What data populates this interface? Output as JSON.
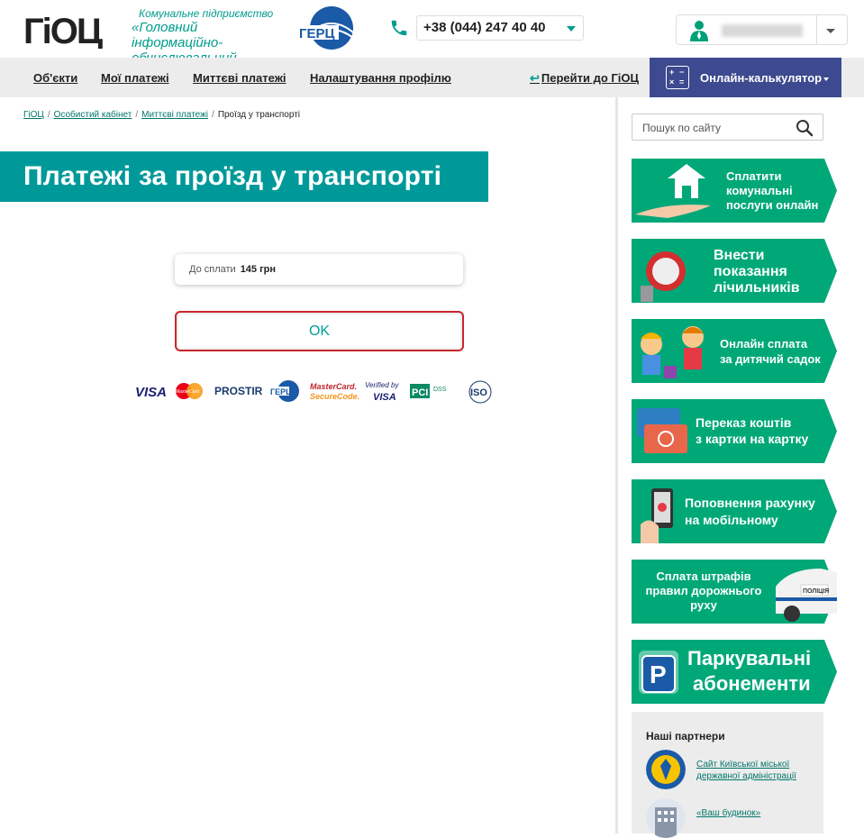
{
  "header": {
    "logo_text": "ГіОЦ",
    "org_line1": "Комунальне підприємство",
    "org_line2": "«Головний інформаційно-",
    "org_line3": "обчислювальний центр»",
    "herc_text": "ГЕРЦ",
    "phone": "+38 (044) 247 40 40"
  },
  "nav": {
    "items": [
      "Об'єкти",
      "Мої платежі",
      "Миттєві платежі",
      "Налаштування профілю"
    ],
    "back_label": "Перейти до ГіОЦ",
    "calc_label": "Онлайн-калькулятор"
  },
  "breadcrumb": {
    "items": [
      "ГіОЦ",
      "Особистий кабінет",
      "Миттєві платежі"
    ],
    "current": "Проїзд у транспорті"
  },
  "page": {
    "title": "Платежі за проїзд у транспорті",
    "amount_label": "До сплати",
    "amount_value": "145 грн",
    "ok_label": "OK"
  },
  "payment_logos": [
    "VISA",
    "MasterCard",
    "PROSTIR",
    "ГЕРЦ",
    "MasterCard SecureCode",
    "Verified by VISA",
    "PCI DSS",
    "ISO"
  ],
  "sidebar": {
    "search_placeholder": "Пошук по сайту",
    "promos": [
      {
        "lines": [
          "Сплатити",
          "комунальні",
          "послуги онлайн"
        ]
      },
      {
        "lines": [
          "Внести",
          "показання",
          "лічильників"
        ]
      },
      {
        "lines": [
          "Онлайн сплата",
          "за дитячий садок"
        ]
      },
      {
        "lines": [
          "Переказ коштів",
          "з картки на картку"
        ]
      },
      {
        "lines": [
          "Поповнення рахунку",
          "на мобільному"
        ]
      },
      {
        "lines": [
          "Сплата штрафів",
          "правил дорожнього",
          "руху"
        ]
      },
      {
        "lines": [
          "Паркувальні",
          "абонементи"
        ]
      }
    ],
    "partners_title": "Наші партнери",
    "partners": [
      "Сайт Київської міської державної адміністрації",
      "«Ваш будинок»"
    ]
  },
  "colors": {
    "brand_teal": "#00999a",
    "nav_bg": "#ececec",
    "calc_bg": "#3d4a8f",
    "promo_green": "#00a878",
    "ok_border": "#c9272d"
  }
}
